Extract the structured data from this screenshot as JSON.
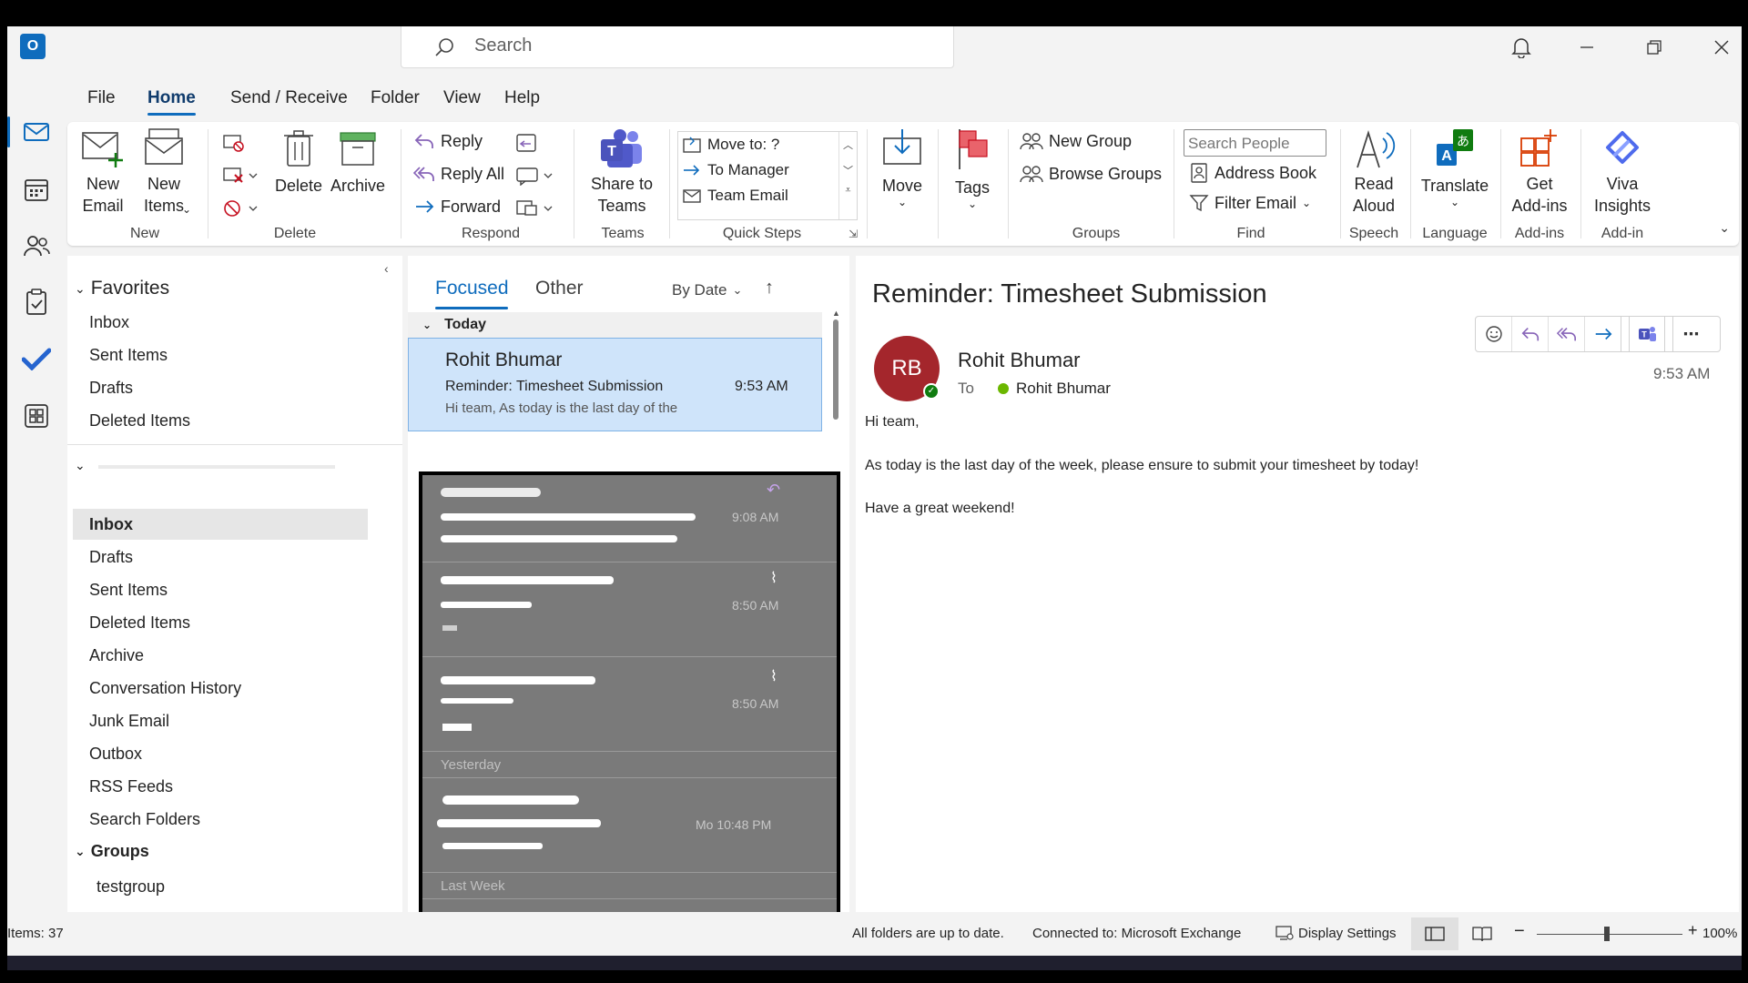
{
  "titlebar": {
    "search_placeholder": "Search"
  },
  "menu": [
    "File",
    "Home",
    "Send / Receive",
    "Folder",
    "View",
    "Help"
  ],
  "ribbon": {
    "new": {
      "new_email": "New\nEmail",
      "new_items": "New\nItems",
      "group": "New"
    },
    "delete": {
      "delete": "Delete",
      "archive": "Archive",
      "group": "Delete"
    },
    "respond": {
      "reply": "Reply",
      "reply_all": "Reply All",
      "forward": "Forward",
      "group": "Respond"
    },
    "teams": {
      "share": "Share to\nTeams",
      "group": "Teams"
    },
    "quick_steps": {
      "items": [
        "Move to: ?",
        "To Manager",
        "Team Email"
      ],
      "group": "Quick Steps"
    },
    "move": {
      "label": "Move"
    },
    "tags": {
      "label": "Tags"
    },
    "groups": {
      "new_group": "New Group",
      "browse_groups": "Browse Groups",
      "group": "Groups"
    },
    "find": {
      "search_people_placeholder": "Search People",
      "address_book": "Address Book",
      "filter_email": "Filter Email",
      "group": "Find"
    },
    "speech": {
      "read_aloud": "Read\nAloud",
      "group": "Speech"
    },
    "language": {
      "translate": "Translate",
      "group": "Language"
    },
    "addins": {
      "get_addins": "Get\nAdd-ins",
      "group": "Add-ins"
    },
    "addin": {
      "viva": "Viva\nInsights",
      "group": "Add-in"
    }
  },
  "folders": {
    "favorites_label": "Favorites",
    "favorites": [
      "Inbox",
      "Sent Items",
      "Drafts",
      "Deleted Items"
    ],
    "account": [
      "Inbox",
      "Drafts",
      "Sent Items",
      "Deleted Items",
      "Archive",
      "Conversation History",
      "Junk Email",
      "Outbox",
      "RSS Feeds",
      "Search Folders"
    ],
    "selected": "Inbox",
    "groups_label": "Groups",
    "groups": [
      "testgroup"
    ]
  },
  "message_list": {
    "tab_focused": "Focused",
    "tab_other": "Other",
    "sort": "By Date",
    "section_today": "Today",
    "section_yesterday": "Yesterday",
    "section_last_week": "Last Week",
    "selected": {
      "sender": "Rohit Bhumar",
      "subject": "Reminder: Timesheet Submission",
      "time": "9:53 AM",
      "preview": "Hi team,   As today is the last day of the"
    },
    "redacted_times": [
      "9:08 AM",
      "8:50 AM",
      "8:50 AM",
      "Mo 10:48 PM"
    ]
  },
  "reading": {
    "subject": "Reminder: Timesheet Submission",
    "avatar_initials": "RB",
    "sender": "Rohit Bhumar",
    "to_label": "To",
    "to_name": "Rohit Bhumar",
    "time": "9:53 AM",
    "body": [
      "Hi team,",
      "As today is the last day of the week, please ensure to submit your timesheet by today!",
      "Have a great weekend!"
    ]
  },
  "status": {
    "items": "Items: 37",
    "sync": "All folders are up to date.",
    "connection": "Connected to: Microsoft Exchange",
    "display_settings": "Display Settings",
    "zoom": "100%"
  },
  "colors": {
    "accent": "#0f6cbd",
    "selected_row": "#cfe4fa",
    "avatar": "#a4262c",
    "redact": "#7a7a7a"
  }
}
